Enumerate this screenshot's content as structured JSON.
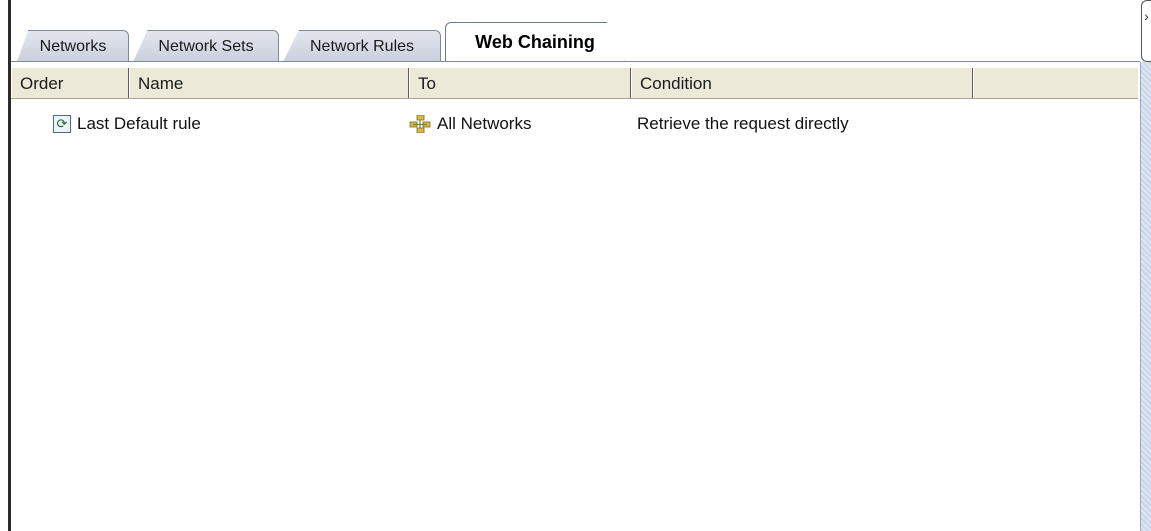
{
  "tabs": [
    {
      "label": "Networks"
    },
    {
      "label": "Network Sets"
    },
    {
      "label": "Network Rules"
    },
    {
      "label": "Web Chaining",
      "active": true
    }
  ],
  "columns": [
    "Order",
    "Name",
    "To",
    "Condition"
  ],
  "rows": [
    {
      "order": "",
      "name_icon": "refresh-icon",
      "name": "Last Default rule",
      "to_icon": "networks-icon",
      "to": "All Networks",
      "condition": "Retrieve the request directly"
    }
  ],
  "collapse_glyph": "›"
}
